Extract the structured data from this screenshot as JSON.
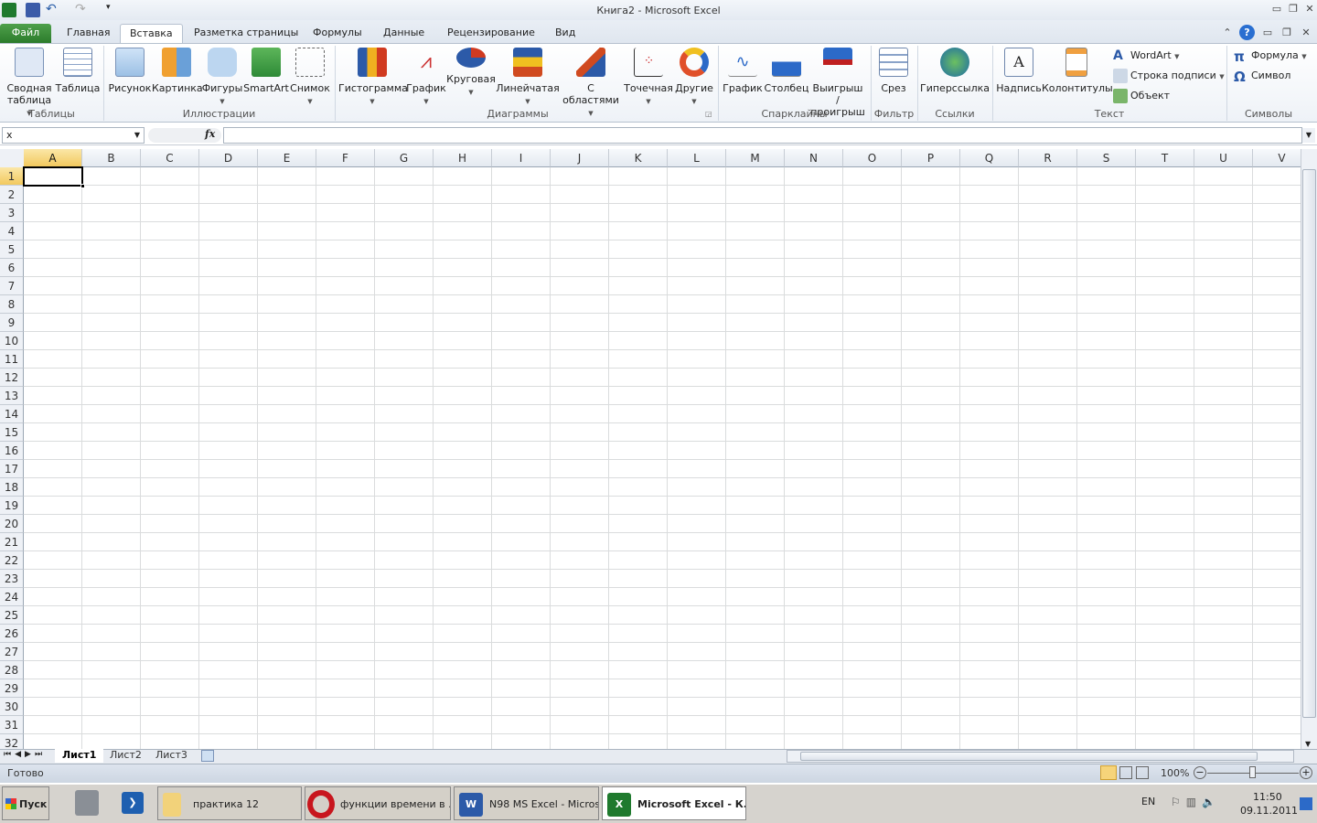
{
  "title": "Книга2 - Microsoft Excel",
  "tabs": [
    "Файл",
    "Главная",
    "Вставка",
    "Разметка страницы",
    "Формулы",
    "Данные",
    "Рецензирование",
    "Вид"
  ],
  "active_tab": "Вставка",
  "ribbon": {
    "groups": {
      "tables": "Таблицы",
      "illustrations": "Иллюстрации",
      "charts": "Диаграммы",
      "sparklines": "Спарклайны",
      "filter": "Фильтр",
      "links": "Ссылки",
      "text": "Текст",
      "symbols": "Символы"
    },
    "pivot_1": "Сводная",
    "pivot_2": "таблица",
    "table": "Таблица",
    "picture": "Рисунок",
    "clipart": "Картинка",
    "shapes": "Фигуры",
    "smartart": "SmartArt",
    "screenshot": "Снимок",
    "column": "Гистограмма",
    "line": "График",
    "pie": "Круговая",
    "bar": "Линейчатая",
    "area_1": "С",
    "area_2": "областями",
    "scatter": "Точечная",
    "other": "Другие",
    "sp_line": "График",
    "sp_column": "Столбец",
    "sp_winloss_1": "Выигрыш /",
    "sp_winloss_2": "проигрыш",
    "slicer": "Срез",
    "hyperlink": "Гиперссылка",
    "textbox": "Надпись",
    "headerfooter": "Колонтитулы",
    "wordart": "WordArt",
    "signature": "Строка подписи",
    "object": "Объект",
    "equation": "Формула",
    "symbol": "Символ"
  },
  "namebox": "x",
  "fx": "fx",
  "formula": "",
  "columns": [
    "A",
    "B",
    "C",
    "D",
    "E",
    "F",
    "G",
    "H",
    "I",
    "J",
    "K",
    "L",
    "M",
    "N",
    "O",
    "P",
    "Q",
    "R",
    "S",
    "T",
    "U",
    "V"
  ],
  "rows": [
    "1",
    "2",
    "3",
    "4",
    "5",
    "6",
    "7",
    "8",
    "9",
    "10",
    "11",
    "12",
    "13",
    "14",
    "15",
    "16",
    "17",
    "18",
    "19",
    "20",
    "21",
    "22",
    "23",
    "24",
    "25",
    "26",
    "27",
    "28",
    "29",
    "30",
    "31",
    "32"
  ],
  "active_cell": "A1",
  "sheets": [
    "Лист1",
    "Лист2",
    "Лист3"
  ],
  "status": {
    "text": "Готово",
    "zoom": "100%"
  },
  "taskbar": {
    "start": "Пуск",
    "items": [
      "практика 12",
      "функции времени в ...",
      "N98 MS Excel - Micros...",
      "Microsoft Excel - К..."
    ],
    "lang": "EN",
    "time": "11:50",
    "date": "09.11.2011"
  }
}
